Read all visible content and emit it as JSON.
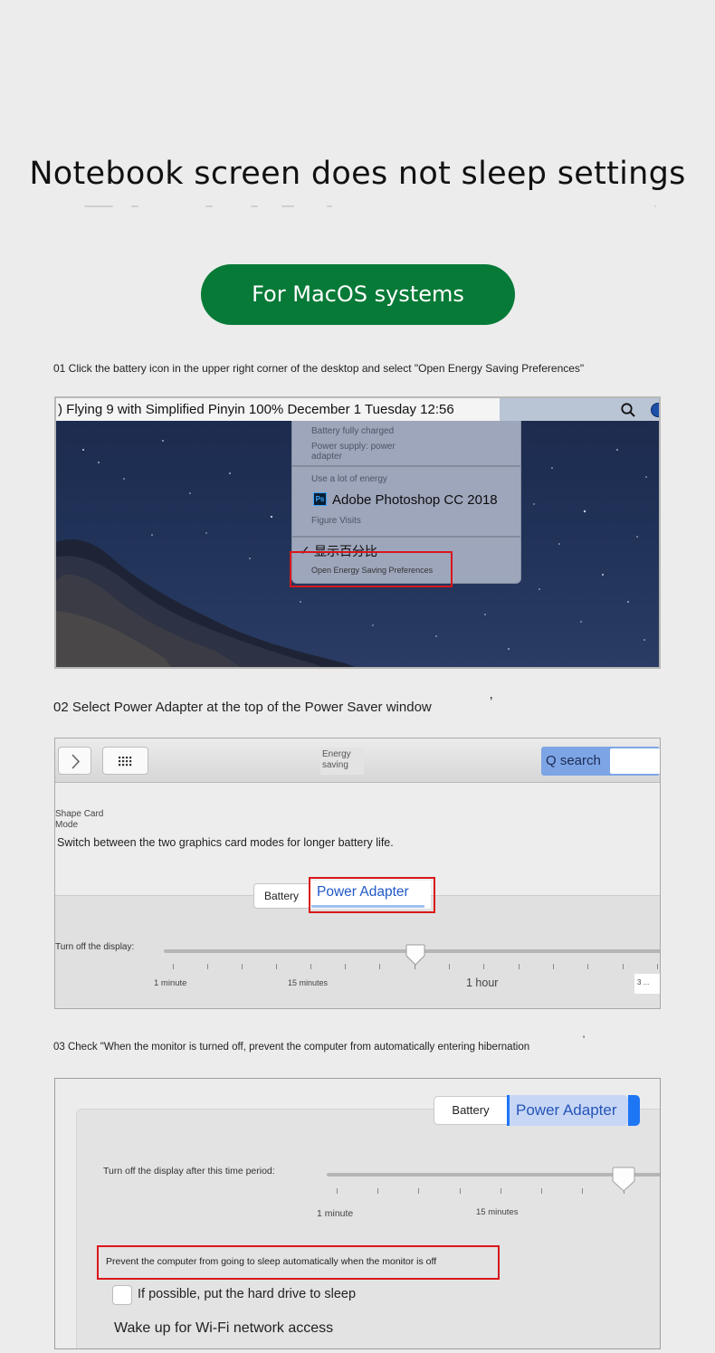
{
  "title": "Notebook screen does not sleep settings",
  "badge": "For MacOS systems",
  "steps": {
    "s1": "01 Click the battery icon in the upper right corner of the desktop and select \"Open Energy Saving Preferences\"",
    "s2": "02 Select Power Adapter at the top of the Power Saver window",
    "s2_mark": "’",
    "s3": "03 Check \"When the monitor is turned off, prevent the computer from automatically entering hibernation",
    "s3_mark": "'"
  },
  "shot1": {
    "menubar_text": ") Flying 9 with Simplified Pinyin 100% December 1 Tuesday 12:56",
    "menu": {
      "battery_status": "Battery fully charged",
      "power_supply": "Power supply: power adapter",
      "energy_heading": "Use a lot of energy",
      "app_name": "Adobe Photoshop CC 2018",
      "app_icon_text": "Ps",
      "figure_visits": "Figure Visits",
      "check": "✓",
      "show_percentage": "显示百分比",
      "open_prefs": "Open Energy Saving Preferences"
    },
    "icons": [
      "search-icon",
      "siri-icon",
      "photoshop-icon"
    ]
  },
  "shot2": {
    "window_title": "Energy saving",
    "search_label": "Q search",
    "mode_label": "Shape Card Mode",
    "description": "Switch between the two graphics card modes for longer battery life.",
    "tab_battery": "Battery",
    "tab_adapter": "Power Adapter",
    "turnoff_label": "Turn off the display:",
    "slider_value": 0.46,
    "tick_labels": {
      "t1": "1 minute",
      "t2": "15 minutes",
      "t3": "1 hour",
      "t4": "3 ..."
    },
    "icons": [
      "chevron-right-icon",
      "grid-icon"
    ]
  },
  "shot3": {
    "tab_battery": "Battery",
    "tab_adapter": "Power Adapter",
    "turnoff_label": "Turn off the display after this time period:",
    "slider_value": 0.9,
    "tick_labels": {
      "t1": "1 minute",
      "t2": "15 minutes"
    },
    "prevent_label": "Prevent the computer from going to sleep automatically when the monitor is off",
    "harddrive_label": "If possible, put the hard drive to sleep",
    "harddrive_checked": false,
    "wifi_label": "Wake up for Wi-Fi network access"
  },
  "colors": {
    "badge_green": "#077a37",
    "highlight_red": "#d9161b",
    "adapter_blue": "#2159c7",
    "accent_blue": "#1e76f5"
  }
}
